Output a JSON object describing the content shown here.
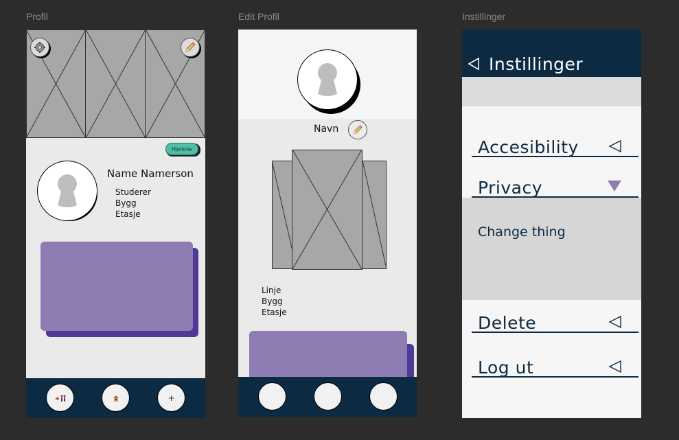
{
  "frames": {
    "profil": {
      "label": "Profil",
      "home_badge": "Hjemme",
      "name": "Name Namerson",
      "details": [
        "Studerer",
        "Bygg",
        "Etasje"
      ],
      "nav_icons": [
        "map-people-icon",
        "person-home-icon",
        "plus-icon"
      ],
      "plus_label": "+"
    },
    "edit": {
      "label": "Edit Profil",
      "name_label": "Navn",
      "details": [
        "Linje",
        "Bygg",
        "Etasje"
      ]
    },
    "settings": {
      "label": "Instillinger",
      "header_title": "Instillinger",
      "items": [
        "Accesibility",
        "Privacy",
        "Change thing",
        "Delete",
        "Log ut"
      ]
    }
  },
  "colors": {
    "navy": "#0c2a42",
    "purple_card": "#8d7db3",
    "purple_shadow": "#4f3a97",
    "teal_badge": "#4fbfa8",
    "panel": "#eaeaea"
  }
}
